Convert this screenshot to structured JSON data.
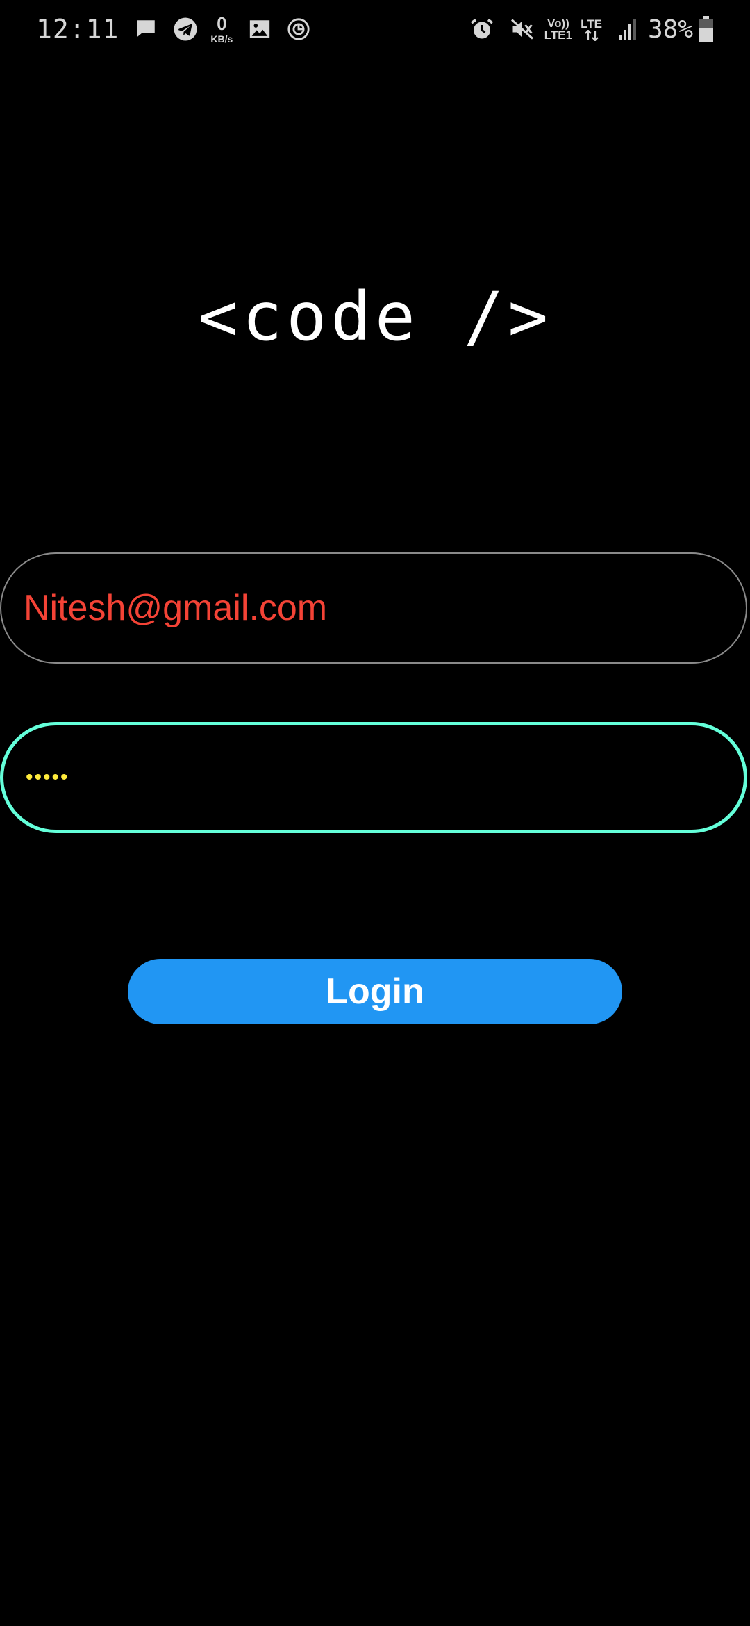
{
  "status_bar": {
    "time": "12:11",
    "net_speed_value": "0",
    "net_speed_unit": "KB/s",
    "volte_top": "Vo))",
    "volte_bottom": "LTE1",
    "lte_label": "LTE",
    "battery_percent": "38%",
    "icons_left": [
      "message-icon",
      "telegram-icon",
      "gallery-icon",
      "sync-icon"
    ],
    "icons_right": [
      "alarm-icon",
      "mute-icon",
      "signal-icon",
      "battery-icon"
    ]
  },
  "logo": {
    "text": "<code />"
  },
  "form": {
    "email_value": "Nitesh@gmail.com",
    "password_value": "•••••",
    "login_label": "Login"
  },
  "colors": {
    "background": "#000000",
    "email_text": "#f44336",
    "password_text": "#ffeb3b",
    "focused_border": "#64ffda",
    "unfocused_border": "#8a8a8a",
    "button": "#2196f3"
  }
}
